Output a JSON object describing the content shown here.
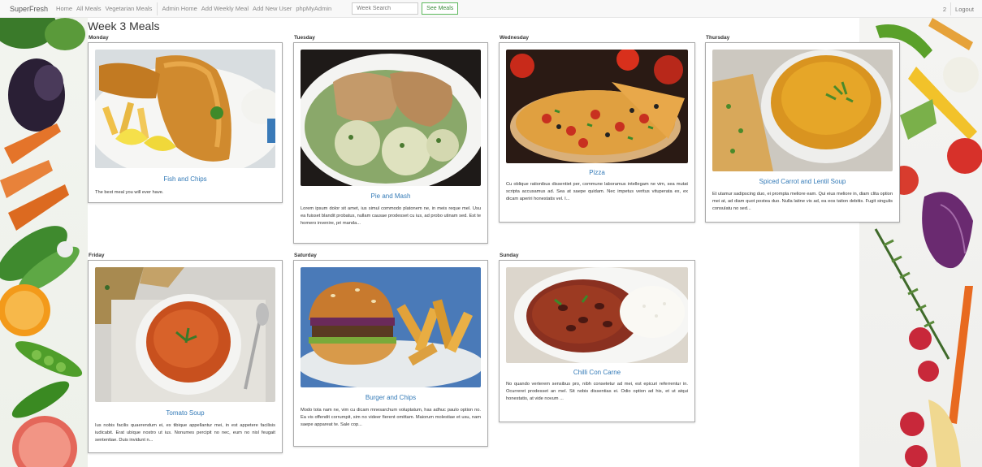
{
  "navbar": {
    "brand": "SuperFresh",
    "links": [
      "Home",
      "All Meals",
      "Vegetarian Meals"
    ],
    "admin_links": [
      "Admin Home",
      "Add Weekly Meal",
      "Add New User",
      "phpMyAdmin"
    ],
    "search_placeholder": "Week Search",
    "see_meals_label": "See Meals",
    "user_number": "2",
    "logout_label": "Logout"
  },
  "page": {
    "title": "Week 3 Meals"
  },
  "meals": [
    {
      "day": "Monday",
      "title": "Fish and Chips",
      "description": "The best meal you will ever have."
    },
    {
      "day": "Tuesday",
      "title": "Pie and Mash",
      "description": "Lorem ipsum dolor sit amet, ius simul commodo platonem ne, in meis reque mel. Usu ea fuisset blandit probatus, nullam causae prodesset cu ius, ad probo utinam sed. Est te homero invenire, pri manda..."
    },
    {
      "day": "Wednesday",
      "title": "Pizza",
      "description": "Cu oblique rationibus dissentiet per, commune laboramus intellegam ne vim, sea mutat scripta accusamus ad. Sea at saepe quidam. Nec impetus veritus vituperata ex, ex dicam aperiri honestatis vel. I..."
    },
    {
      "day": "Thursday",
      "title": "Spiced Carrot and Lentil Soup",
      "description": "Et utamur sadipscing duo, ei prompta meliore eam. Qui eius meliore in, diam clita option mei at, ad diam quot postea duo. Nulla latine vis ad, ea eos tation debitis. Fugit singulis consulatu no sed..."
    },
    {
      "day": "Friday",
      "title": "Tomato Soup",
      "description": "Ius nobis facilis quaerendum ei, ex tibique appellantur mei, in est appetere facilisis iudicabit. Erat ubique nostro ut ius. Nonumes percipit no nec, eum no nisl feugait sententiae. Duis invidunt n..."
    },
    {
      "day": "Saturday",
      "title": "Burger and Chips",
      "description": "Modo tota nam ne, vim cu dicam mnesarchum voluptatum, has adhuc paulo option no. Ea vis offendit corrumpit, sim no videer fierent omittam. Maiorum molestiae et usu, nam saepe appareat te. Sale cop..."
    },
    {
      "day": "Sunday",
      "title": "Chilli Con Carne",
      "description": "No quando verterem sensibus pro, nibh consetetur ad mei, est epicuri referrentur in. Ocurreret prodesset an mel. Sit nobis dissentias ei. Odio option ad his, et ut atqui honestatis, at vide novum ..."
    }
  ],
  "colors": {
    "link": "#337ab7",
    "see_meals_border": "#5cb85c"
  }
}
